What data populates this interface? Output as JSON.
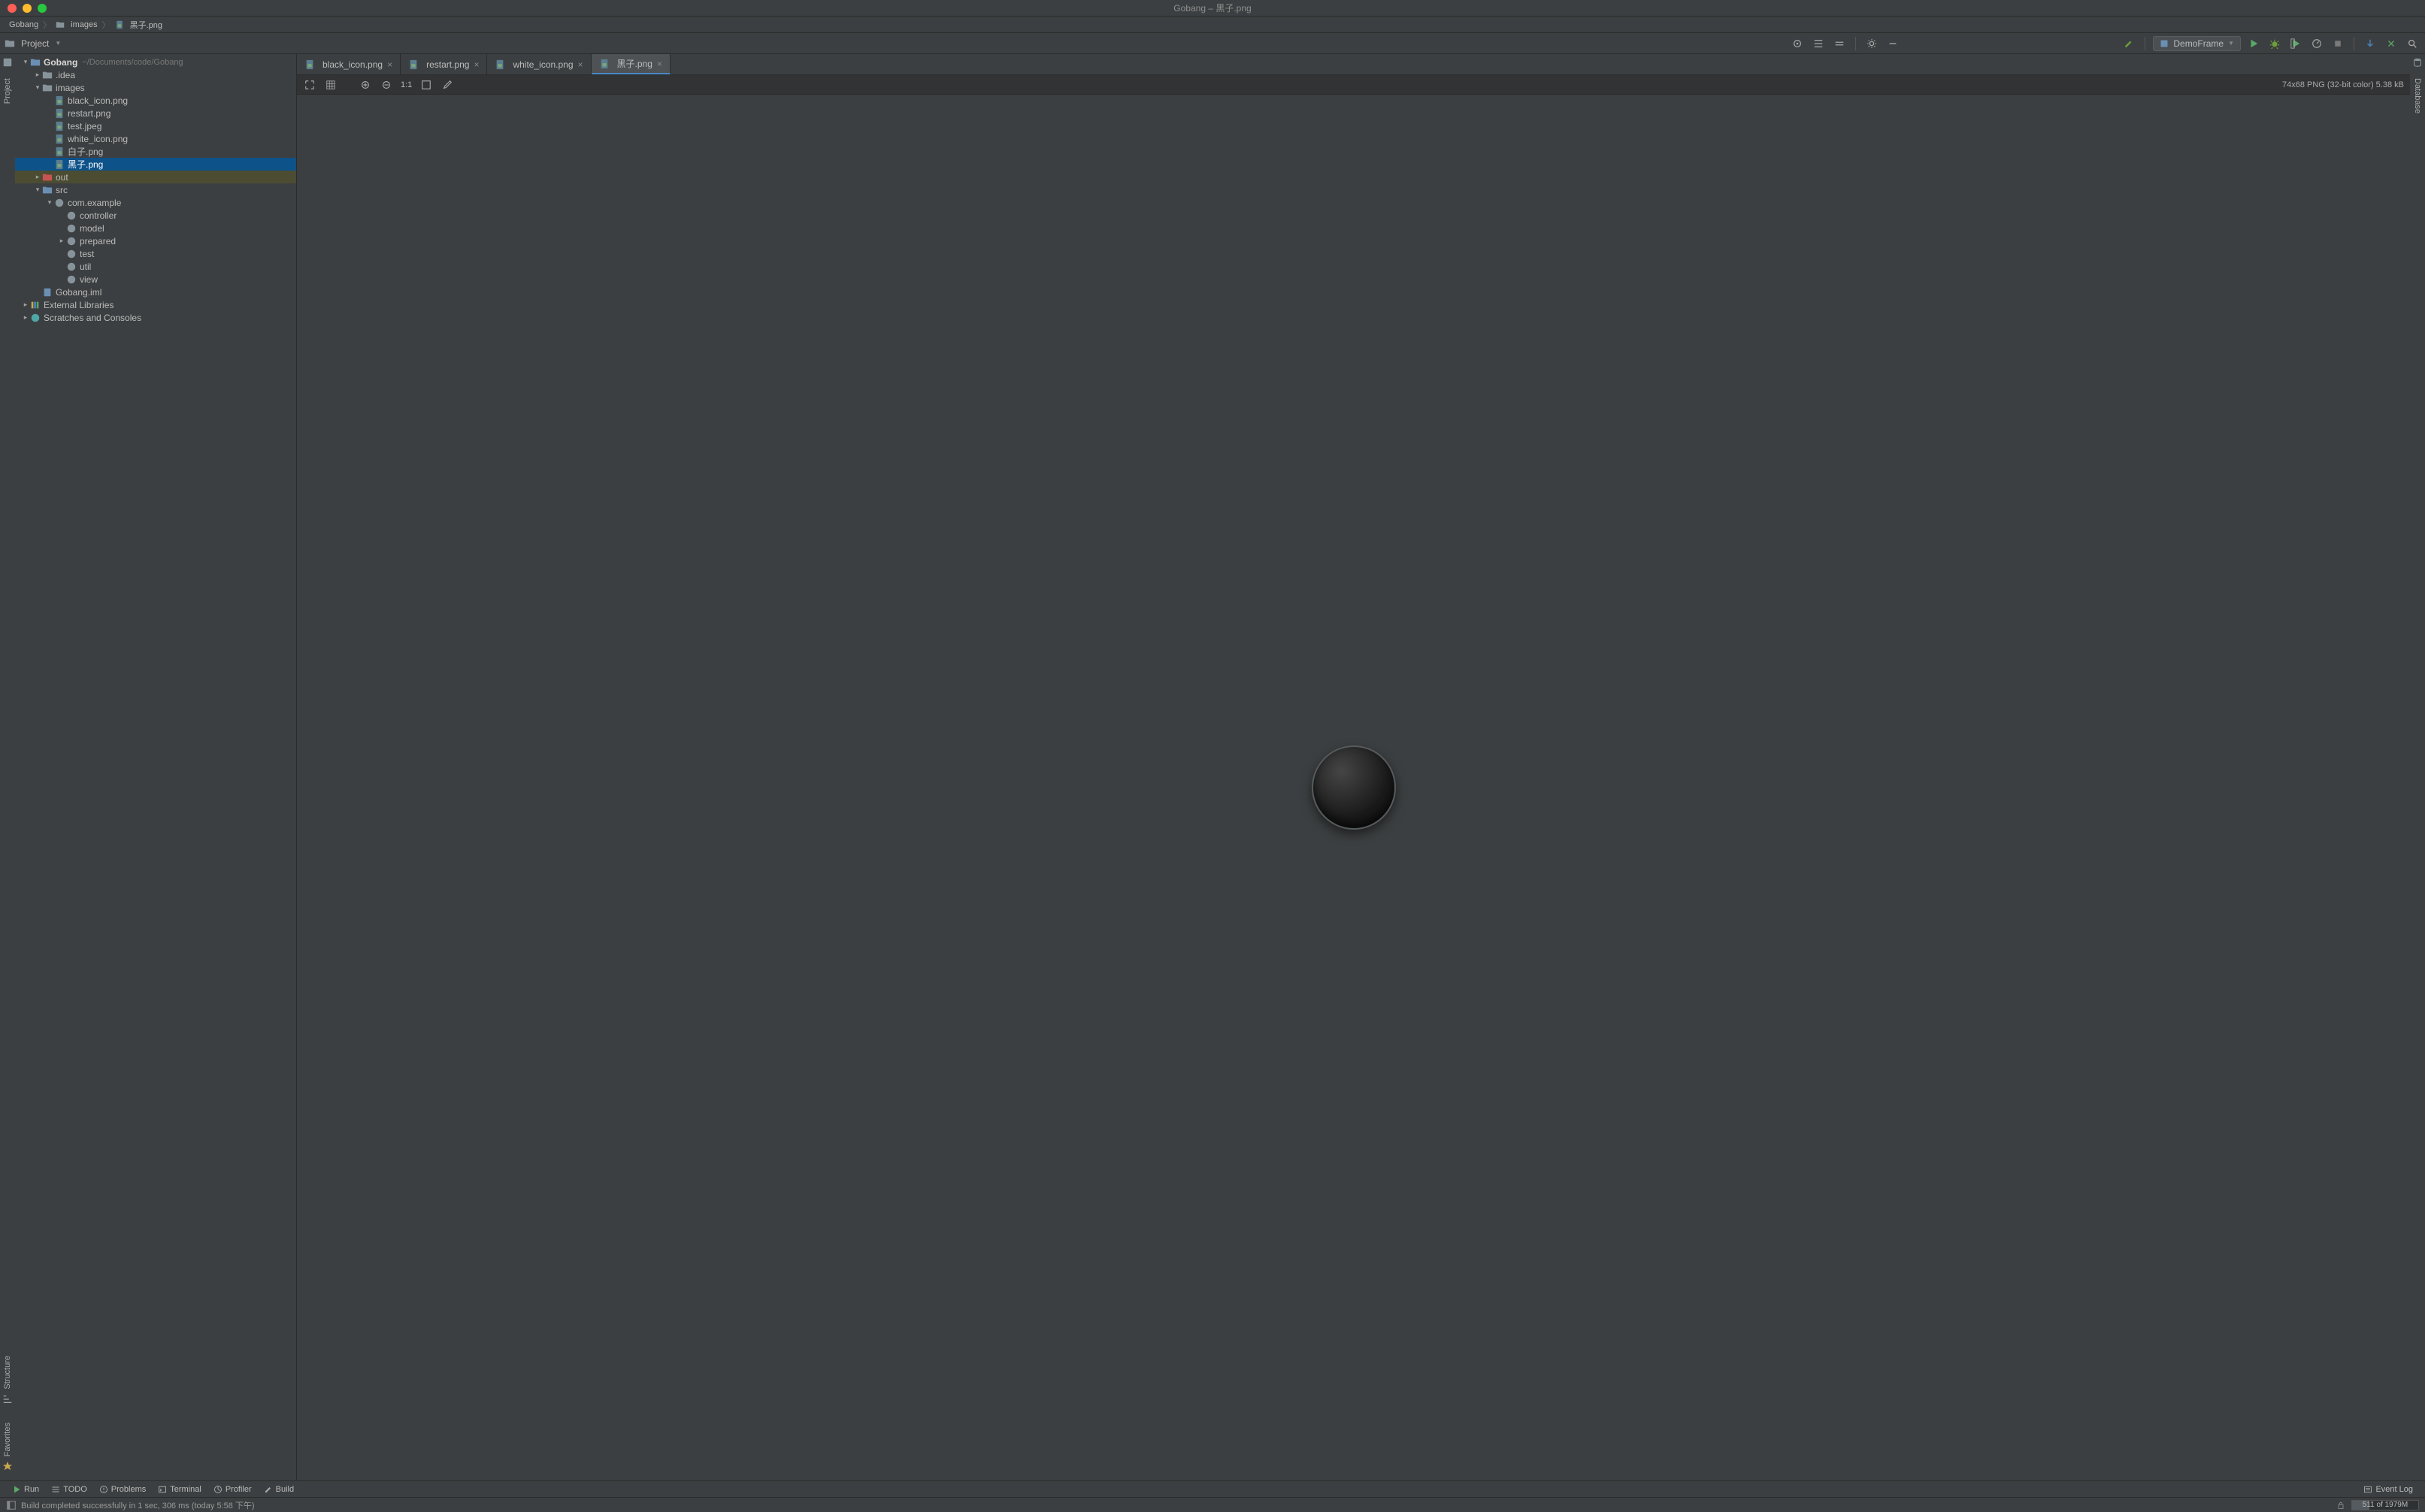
{
  "window_title": "Gobang – 黑子.png",
  "breadcrumbs": [
    "Gobang",
    "images",
    "黑子.png"
  ],
  "project_label": "Project",
  "run_config": "DemoFrame",
  "tree": {
    "root": {
      "label": "Gobang",
      "sub": "~/Documents/code/Gobang"
    },
    "idea": ".idea",
    "images": "images",
    "files": {
      "black_icon": "black_icon.png",
      "restart": "restart.png",
      "test_jpeg": "test.jpeg",
      "white_icon": "white_icon.png",
      "baizi": "白子.png",
      "heizi": "黑子.png"
    },
    "out": "out",
    "src": "src",
    "pkg": "com.example",
    "subpkgs": {
      "controller": "controller",
      "model": "model",
      "prepared": "prepared",
      "test": "test",
      "util": "util",
      "view": "view"
    },
    "iml": "Gobang.iml",
    "ext_lib": "External Libraries",
    "scratches": "Scratches and Consoles"
  },
  "tabs": [
    {
      "label": "black_icon.png",
      "active": false
    },
    {
      "label": "restart.png",
      "active": false
    },
    {
      "label": "white_icon.png",
      "active": false
    },
    {
      "label": "黑子.png",
      "active": true
    }
  ],
  "image_info": "74x68 PNG (32-bit color) 5.38 kB",
  "img_toolbar": {
    "zoom_label": "1:1"
  },
  "left_strip": {
    "project": "Project",
    "structure": "Structure",
    "favorites": "Favorites"
  },
  "right_strip": {
    "database": "Database"
  },
  "bottom_strip": {
    "run": "Run",
    "todo": "TODO",
    "problems": "Problems",
    "terminal": "Terminal",
    "profiler": "Profiler",
    "build": "Build",
    "event_log": "Event Log"
  },
  "status_msg": "Build completed successfully in 1 sec, 306 ms (today 5:58 下午)",
  "memory": "511 of 1979M"
}
